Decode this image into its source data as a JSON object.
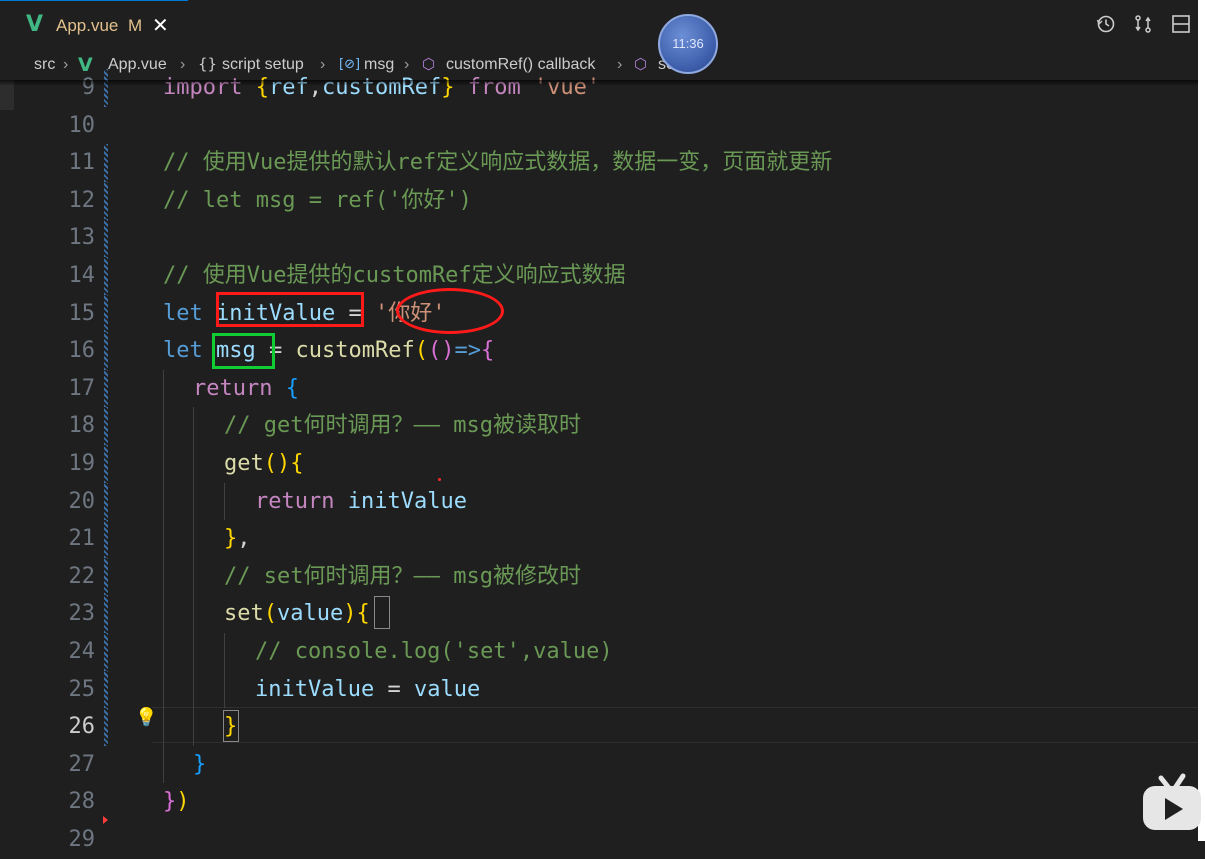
{
  "tab": {
    "file_name": "App.vue",
    "status": "M",
    "close": "✕"
  },
  "toolbar": {
    "timeline_icon": "history-icon",
    "compare_icon": "compare-changes-icon",
    "split_icon": "split-editor-icon"
  },
  "breadcrumb": {
    "items": [
      "src",
      "App.vue",
      "script setup",
      "msg",
      "customRef() callback",
      "set"
    ],
    "icons": [
      "folder",
      "vue-file-icon",
      "braces-icon",
      "variable-icon",
      "cube-icon",
      "cube-icon"
    ]
  },
  "overlay": {
    "clock_time": "11:36"
  },
  "editor": {
    "active_line": 26,
    "lines": [
      {
        "n": "9",
        "text": "import {ref,customRef} from 'vue'"
      },
      {
        "n": "10",
        "text": ""
      },
      {
        "n": "11",
        "text": "// 使用Vue提供的默认ref定义响应式数据，数据一变，页面就更新"
      },
      {
        "n": "12",
        "text": "// let msg = ref('你好')"
      },
      {
        "n": "13",
        "text": ""
      },
      {
        "n": "14",
        "text": "// 使用Vue提供的customRef定义响应式数据"
      },
      {
        "n": "15",
        "text": "let initValue = '你好'"
      },
      {
        "n": "16",
        "text": "let msg = customRef(()=>{"
      },
      {
        "n": "17",
        "text": "return {"
      },
      {
        "n": "18",
        "text": "// get何时调用？—— msg被读取时"
      },
      {
        "n": "19",
        "text": "get(){"
      },
      {
        "n": "20",
        "text": "return initValue"
      },
      {
        "n": "21",
        "text": "},"
      },
      {
        "n": "22",
        "text": "// set何时调用？—— msg被修改时"
      },
      {
        "n": "23",
        "text": "set(value){"
      },
      {
        "n": "24",
        "text": "// console.log('set',value)"
      },
      {
        "n": "25",
        "text": "initValue = value"
      },
      {
        "n": "26",
        "text": "}"
      },
      {
        "n": "27",
        "text": "}"
      },
      {
        "n": "28",
        "text": "})"
      },
      {
        "n": "29",
        "text": ""
      }
    ]
  },
  "colors": {
    "background": "#1f1f1f",
    "keyword": "#569cd6",
    "variable": "#9cdcfe",
    "function": "#dcdcaa",
    "string": "#ce9178",
    "comment": "#6a9955",
    "annotation_red": "#ff1a1a",
    "annotation_green": "#11cc33",
    "vue_green": "#41b883"
  },
  "watermark": {
    "logo": "bilibili-tv-logo"
  }
}
